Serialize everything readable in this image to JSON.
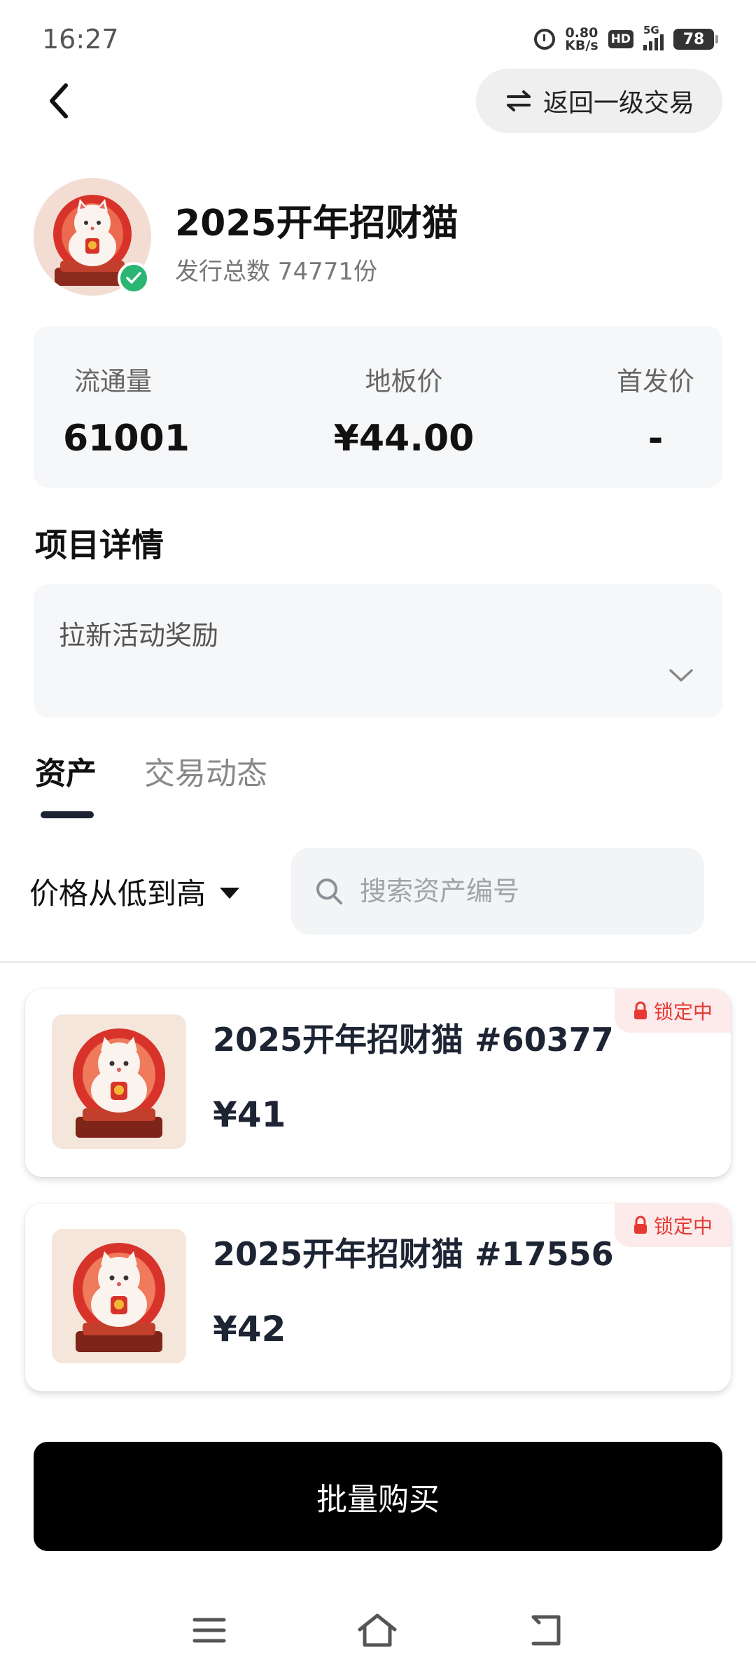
{
  "status_bar": {
    "time": "16:27",
    "network_speed_value": "0.80",
    "network_speed_unit": "KB/s",
    "hd_label": "HD",
    "signal_label": "5G",
    "battery": "78",
    "icons": [
      "alarm-icon",
      "hd-icon",
      "signal-icon",
      "battery-icon"
    ]
  },
  "header": {
    "back_icon": "chevron-left-icon",
    "switch_label": "返回一级交易",
    "switch_icon": "swap-arrows-icon"
  },
  "collection": {
    "title": "2025开年招财猫",
    "subtitle": "发行总数 74771份",
    "verified_icon": "check-icon"
  },
  "stats": [
    {
      "label": "流通量",
      "value": "61001"
    },
    {
      "label": "地板价",
      "value": "¥44.00"
    },
    {
      "label": "首发价",
      "value": "-"
    }
  ],
  "project": {
    "section_title": "项目详情",
    "description": "拉新活动奖励",
    "expand_icon": "chevron-down-icon"
  },
  "tabs": [
    {
      "label": "资产",
      "active": true
    },
    {
      "label": "交易动态",
      "active": false
    }
  ],
  "filter": {
    "sort_label": "价格从低到高",
    "search_placeholder": "搜索资产编号",
    "search_value": ""
  },
  "assets": [
    {
      "name": "2025开年招财猫 #60377",
      "price": "¥41",
      "status": "锁定中"
    },
    {
      "name": "2025开年招财猫 #17556",
      "price": "¥42",
      "status": "锁定中"
    }
  ],
  "actions": {
    "bulk_buy": "批量购买"
  },
  "navbar": {
    "icons": [
      "menu-icon",
      "home-icon",
      "back-icon"
    ]
  },
  "colors": {
    "primary_button": "#000000",
    "lock_text": "#e53935",
    "lock_bg": "#fdeaea",
    "verified": "#2bb673",
    "card_bg": "#f6f7f9"
  }
}
